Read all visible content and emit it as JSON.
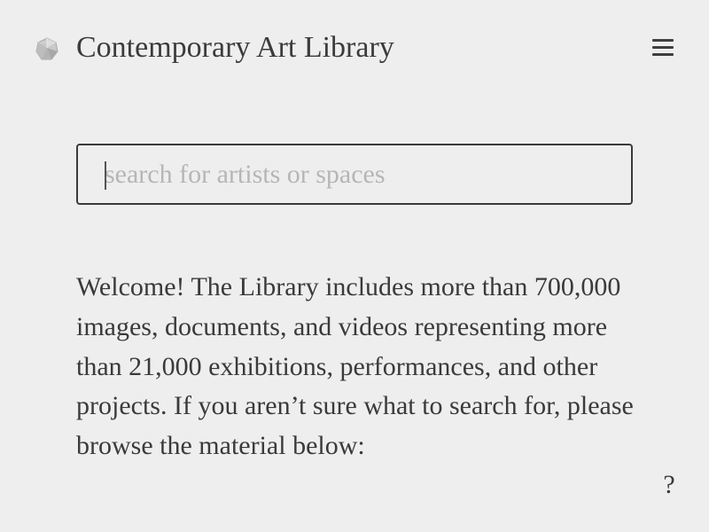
{
  "header": {
    "logo_icon": "gem-icon",
    "title": "Contemporary Art Library",
    "menu_icon": "hamburger-menu-icon"
  },
  "search": {
    "value": "",
    "placeholder": "search for artists or spaces"
  },
  "main": {
    "welcome": "Welcome! The Library includes more than 700,000 images, documents, and videos representing more than 21,000 exhibitions, performances, and other projects. If you aren’t sure what to search for, please browse the material below:"
  },
  "help": {
    "label": "?"
  },
  "colors": {
    "background": "#eeeeee",
    "text": "#3a3a3a",
    "placeholder": "#b6b6b6",
    "border": "#3a3a3a"
  }
}
